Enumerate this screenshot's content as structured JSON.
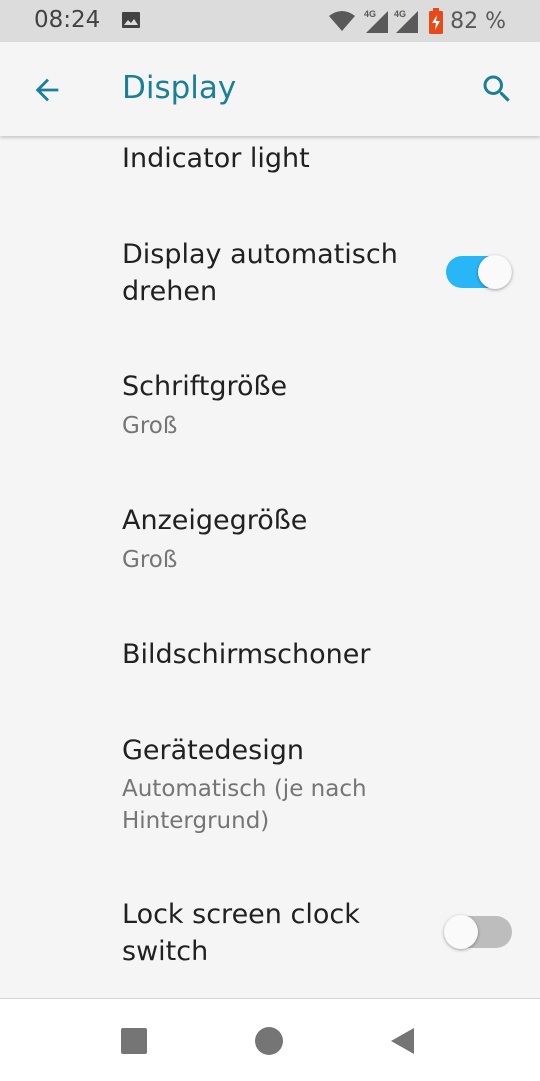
{
  "status_bar": {
    "time": "08:24",
    "battery": "82 %",
    "icons": [
      "image-icon",
      "wifi-icon",
      "signal-4g-icon",
      "signal-4g-icon",
      "battery-charging-icon"
    ],
    "network_labels": [
      "4G",
      "4G"
    ]
  },
  "app_bar": {
    "title": "Display",
    "back_icon": "arrow-back-icon",
    "search_icon": "search-icon"
  },
  "settings": [
    {
      "title": "Indicator light"
    },
    {
      "title": "Display automatisch drehen",
      "toggle": true,
      "on": true
    },
    {
      "title": "Schriftgröße",
      "subtitle": "Groß"
    },
    {
      "title": "Anzeigegröße",
      "subtitle": "Groß"
    },
    {
      "title": "Bildschirmschoner"
    },
    {
      "title": "Gerätedesign",
      "subtitle": "Automatisch (je nach Hintergrund)"
    },
    {
      "title": "Lock screen clock switch",
      "toggle": true,
      "on": false
    }
  ],
  "nav_bar": {
    "icons": [
      "recents-icon",
      "home-icon",
      "back-icon"
    ]
  },
  "colors": {
    "accent": "#1b7f98",
    "toggle_on": "#29b6f6",
    "toggle_off": "#bdbdbd"
  }
}
